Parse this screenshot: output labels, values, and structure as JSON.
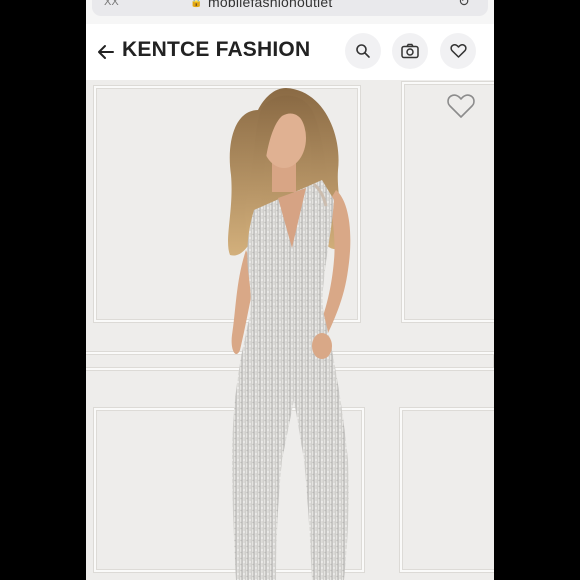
{
  "browser": {
    "status_left": "XX",
    "url": "mobilefashionoutlet"
  },
  "header": {
    "title": "KENTCE FASHION",
    "icons": {
      "back": "arrow-left-icon",
      "search": "search-icon",
      "camera": "camera-icon",
      "wishlist": "heart-icon"
    }
  },
  "product": {
    "image_description_icon": "product-photo",
    "wishlist_icon": "heart-outline-icon"
  },
  "colors": {
    "background": "#000000",
    "header_bg": "#ffffff",
    "icon_button_bg": "#f1f1f3",
    "title_text": "#222222",
    "photo_wall": "#eeedeb"
  }
}
